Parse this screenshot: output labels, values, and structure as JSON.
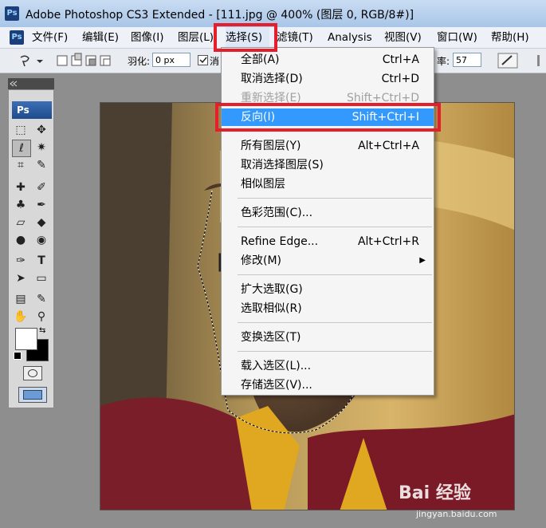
{
  "window": {
    "title": "Adobe Photoshop CS3 Extended - [111.jpg @ 400% (图层 0, RGB/8#)]",
    "app_icon": "Ps"
  },
  "menubar": {
    "ps_icon": "Ps",
    "items": [
      {
        "label": "文件(F)"
      },
      {
        "label": "编辑(E)"
      },
      {
        "label": "图像(I)"
      },
      {
        "label": "图层(L)"
      },
      {
        "label": "选择(S)"
      },
      {
        "label": "滤镜(T)"
      },
      {
        "label": "Analysis"
      },
      {
        "label": "视图(V)"
      },
      {
        "label": "窗口(W)"
      },
      {
        "label": "帮助(H)"
      }
    ],
    "active": "选择(S)"
  },
  "options_bar": {
    "feather_label": "羽化:",
    "feather_value": "0 px",
    "antialias_label": "消",
    "resolution_label": "率:",
    "resolution_value": "57"
  },
  "toolbox": {
    "header": "Ps",
    "tools": [
      "marquee-icon",
      "move-icon",
      "lasso-icon",
      "magic-wand-icon",
      "crop-icon",
      "eyedropper-icon",
      "healing-icon",
      "brush-icon",
      "stamp-icon",
      "history-brush-icon",
      "eraser-icon",
      "bucket-icon",
      "blur-icon",
      "dodge-icon",
      "pen-icon",
      "type-icon",
      "path-select-icon",
      "shape-icon",
      "notes-icon",
      "sampler-icon",
      "hand-icon",
      "zoom-icon"
    ],
    "foreground_color": "#ffffff",
    "background_color": "#000000"
  },
  "select_menu": {
    "items": [
      {
        "label": "全部(A)",
        "shortcut": "Ctrl+A"
      },
      {
        "label": "取消选择(D)",
        "shortcut": "Ctrl+D"
      },
      {
        "label": "重新选择(E)",
        "shortcut": "Shift+Ctrl+D",
        "disabled": true
      },
      {
        "label": "反向(I)",
        "shortcut": "Shift+Ctrl+I",
        "highlighted": true
      },
      {
        "label": "所有图层(Y)",
        "shortcut": "Alt+Ctrl+A"
      },
      {
        "label": "取消选择图层(S)",
        "shortcut": ""
      },
      {
        "label": "相似图层",
        "shortcut": ""
      },
      {
        "label": "色彩范围(C)...",
        "shortcut": ""
      },
      {
        "label": "Refine Edge...",
        "shortcut": "Alt+Ctrl+R"
      },
      {
        "label": "修改(M)",
        "shortcut": "▶"
      },
      {
        "label": "扩大选取(G)",
        "shortcut": ""
      },
      {
        "label": "选取相似(R)",
        "shortcut": ""
      },
      {
        "label": "变换选区(T)",
        "shortcut": ""
      },
      {
        "label": "载入选区(L)...",
        "shortcut": ""
      },
      {
        "label": "存储选区(V)...",
        "shortcut": ""
      }
    ]
  },
  "watermark": {
    "text": "Bai 经验",
    "url": "jingyan.baidu.com"
  },
  "colors": {
    "highlight": "#3399ff",
    "annotation_red": "#e41f2b"
  }
}
